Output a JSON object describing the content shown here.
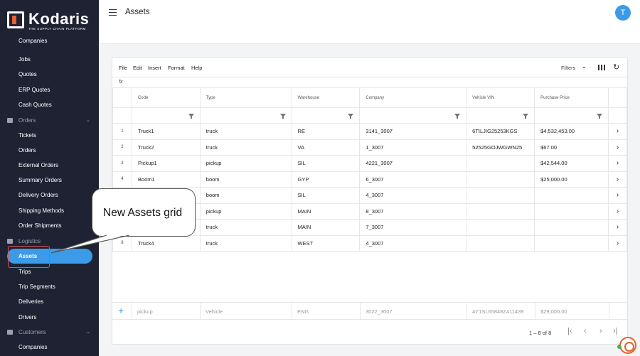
{
  "brand": {
    "name": "Kodaris",
    "tagline": "THE SUPPLY CHAIN PLATFORM"
  },
  "sidebar": {
    "items": [
      {
        "label": "Companies",
        "kind": "item"
      },
      {
        "label": "Jobs",
        "kind": "item"
      },
      {
        "label": "Quotes",
        "kind": "item"
      },
      {
        "label": "ERP Quotes",
        "kind": "item"
      },
      {
        "label": "Cash Quotes",
        "kind": "item"
      },
      {
        "label": "Orders",
        "kind": "group"
      },
      {
        "label": "Tickets",
        "kind": "item"
      },
      {
        "label": "Orders",
        "kind": "item"
      },
      {
        "label": "External Orders",
        "kind": "item"
      },
      {
        "label": "Summary Orders",
        "kind": "item"
      },
      {
        "label": "Delivery Orders",
        "kind": "item"
      },
      {
        "label": "Shipping Methods",
        "kind": "item"
      },
      {
        "label": "Order Shipments",
        "kind": "item"
      },
      {
        "label": "Logistics",
        "kind": "group"
      },
      {
        "label": "Assets",
        "kind": "active"
      },
      {
        "label": "Trips",
        "kind": "item"
      },
      {
        "label": "Trip Segments",
        "kind": "item"
      },
      {
        "label": "Deliveries",
        "kind": "item"
      },
      {
        "label": "Drivers",
        "kind": "item"
      },
      {
        "label": "Customers",
        "kind": "group"
      },
      {
        "label": "Companies",
        "kind": "item"
      }
    ]
  },
  "header": {
    "title": "Assets",
    "avatar_initial": "T"
  },
  "toolbar": {
    "menus": [
      "File",
      "Edit",
      "Insert",
      "Format",
      "Help"
    ],
    "filters_label": "Filters",
    "formula_label": "fx"
  },
  "grid": {
    "columns": [
      "Code",
      "Type",
      "Warehouse",
      "Company",
      "Vehicle VIN",
      "Purchase Price"
    ],
    "rows": [
      {
        "num": "1",
        "cells": [
          "Truck1",
          "truck",
          "RE",
          "3141_3007",
          "6TILJIG25253KGS",
          "$4,532,453.00"
        ]
      },
      {
        "num": "2",
        "cells": [
          "Truck2",
          "truck",
          "VA",
          "1_3007",
          "52525GOJWGWN25",
          "$67.00"
        ]
      },
      {
        "num": "3",
        "cells": [
          "Pickup1",
          "pickup",
          "SIL",
          "4221_3007",
          "",
          "$42,544.00"
        ]
      },
      {
        "num": "4",
        "cells": [
          "Boom1",
          "boom",
          "GYP",
          "6_3007",
          "",
          "$25,000.00"
        ]
      },
      {
        "num": "",
        "cells": [
          "",
          "boom",
          "SIL",
          "4_3007",
          "",
          ""
        ]
      },
      {
        "num": "",
        "cells": [
          "",
          "pickup",
          "MAIN",
          "8_3007",
          "",
          ""
        ]
      },
      {
        "num": "",
        "cells": [
          "",
          "truck",
          "MAIN",
          "7_3007",
          "",
          ""
        ]
      },
      {
        "num": "8",
        "cells": [
          "Truck4",
          "truck",
          "WEST",
          "4_3007",
          "",
          ""
        ]
      }
    ],
    "new_row": [
      "pickup",
      "Vehicle",
      "ENG",
      "3022_3007",
      "4Y1SL65848Z411439",
      "$29,000.00"
    ],
    "pagination": "1 – 8 of 8"
  },
  "annotation": {
    "text": "New Assets grid"
  }
}
